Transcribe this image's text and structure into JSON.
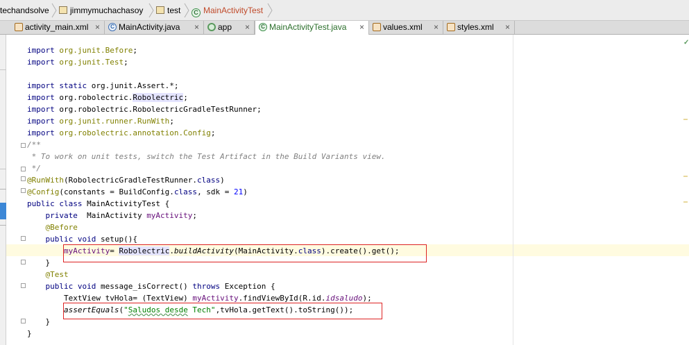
{
  "breadcrumbs": [
    {
      "label": "techandsolve"
    },
    {
      "label": "jimmymuchachasoy"
    },
    {
      "label": "test"
    },
    {
      "label": "MainActivityTest"
    }
  ],
  "tabs": [
    {
      "label": "activity_main.xml",
      "icon": "xml-icon"
    },
    {
      "label": "MainActivity.java",
      "icon": "class-icon"
    },
    {
      "label": "app",
      "icon": "app-module-icon"
    },
    {
      "label": "MainActivityTest.java",
      "icon": "test-class-icon",
      "active": true
    },
    {
      "label": "values.xml",
      "icon": "xml-icon"
    },
    {
      "label": "styles.xml",
      "icon": "xml-icon"
    }
  ],
  "tab_close_glyph": "×",
  "code": {
    "l1a": "import ",
    "l1b": "org.junit.Before",
    "l1c": ";",
    "l2a": "import ",
    "l2b": "org.junit.Test",
    "l2c": ";",
    "l4a": "import static ",
    "l4b": "org.junit.Assert.*;",
    "l5a": "import ",
    "l5b": "org.robolectric.",
    "l5c": "Robolectric",
    "l5d": ";",
    "l6a": "import ",
    "l6b": "org.robolectric.RobolectricGradleTestRunner;",
    "l7a": "import ",
    "l7b": "org.junit.runner.RunWith",
    "l7c": ";",
    "l8a": "import ",
    "l8b": "org.robolectric.annotation.Config",
    "l8c": ";",
    "l9": "/**",
    "l10": " * To work on unit tests, switch the Test Artifact in the Build Variants view.",
    "l11": " */",
    "l12a": "@RunWith",
    "l12b": "(RobolectricGradleTestRunner.",
    "l12c": "class",
    "l12d": ")",
    "l13a": "@Config",
    "l13b": "(constants = BuildConfig.",
    "l13c": "class",
    "l13d": ", sdk = ",
    "l13e": "21",
    "l13f": ")",
    "l14a": "public class ",
    "l14b": "MainActivityTest {",
    "l15a": "    private  ",
    "l15b": "MainActivity ",
    "l15c": "myActivity",
    "l15d": ";",
    "l16": "    @Before",
    "l17a": "    public void ",
    "l17b": "setup(){",
    "l18a": "        ",
    "l18b": "myActivity",
    "l18c": "= ",
    "l18d": "Robolectric",
    "l18e": ".",
    "l18f": "buildActivity",
    "l18g": "(MainActivity.",
    "l18h": "class",
    "l18i": ").create().get();",
    "l19": "    }",
    "l20": "    @Test",
    "l21a": "    public void ",
    "l21b": "message_isCorrect() ",
    "l21c": "throws ",
    "l21d": "Exception {",
    "l22a": "        TextView tvHola= (TextView) ",
    "l22b": "myActivity",
    "l22c": ".findViewById(R.id.",
    "l22d": "idsaludo",
    "l22e": ");",
    "l23a": "        ",
    "l23b": "assertEquals",
    "l23c": "(",
    "l23d": "\"",
    "l23e": "Saludos desde",
    "l23f": " Tech\"",
    "l23g": ",tvHola.getText().toString());",
    "l24": "    }",
    "l25": "}"
  }
}
